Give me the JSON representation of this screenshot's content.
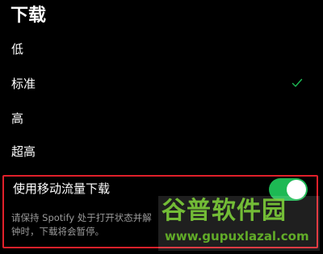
{
  "section": {
    "title": "下载"
  },
  "quality_options": [
    {
      "label": "低",
      "selected": false
    },
    {
      "label": "标准",
      "selected": true
    },
    {
      "label": "高",
      "selected": false
    },
    {
      "label": "超高",
      "selected": false
    }
  ],
  "mobile_download": {
    "label": "使用移动流量下载",
    "enabled": true,
    "description_line1": "请保持 Spotify 处于打开状态并解",
    "description_line2": "钟时，下载将会暂停。"
  },
  "watermark": {
    "brand": "谷普软件园",
    "url": "www.gupuxlazal.com"
  },
  "colors": {
    "background": "#000000",
    "accent_green": "#1db954",
    "highlight_border": "#e0202a",
    "secondary_text": "#9a9a9a"
  },
  "icons": {
    "selected_indicator": "check-icon"
  }
}
